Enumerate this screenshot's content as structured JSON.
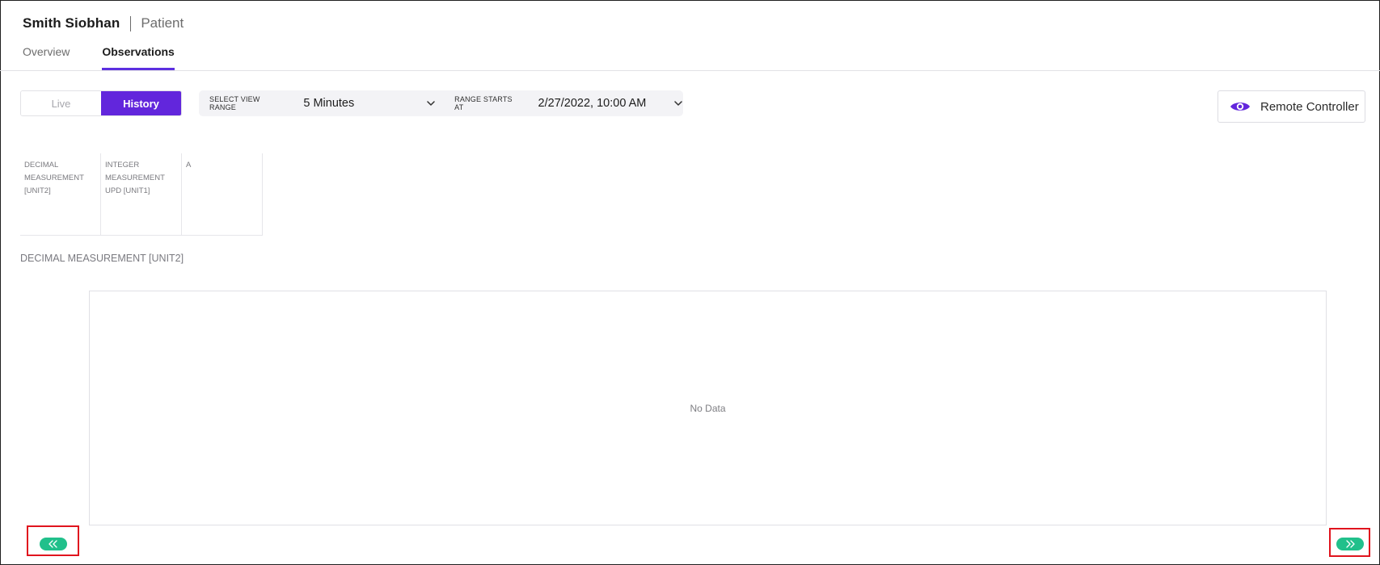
{
  "header": {
    "patient_name": "Smith Siobhan",
    "role": "Patient",
    "tabs": [
      {
        "label": "Overview",
        "active": false
      },
      {
        "label": "Observations",
        "active": true
      }
    ]
  },
  "toolbar": {
    "mode_toggle": {
      "live_label": "Live",
      "history_label": "History",
      "selected": "History"
    },
    "view_range": {
      "label": "SELECT VIEW RANGE",
      "value": "5 Minutes"
    },
    "range_start": {
      "label": "RANGE STARTS AT",
      "value": "2/27/2022, 10:00 AM"
    },
    "remote_controller": {
      "label": "Remote Controller",
      "icon": "eye-icon"
    }
  },
  "measurements": [
    {
      "label": "DECIMAL MEASUREMENT [UNIT2]"
    },
    {
      "label": "INTEGER MEASUREMENT UPD [UNIT1]"
    },
    {
      "label": "A"
    }
  ],
  "chart": {
    "title": "DECIMAL MEASUREMENT [UNIT2]",
    "empty_text": "No Data"
  },
  "navigation": {
    "prev_icon": "double-chevron-left-icon",
    "next_icon": "double-chevron-right-icon"
  },
  "colors": {
    "accent": "#6226dc",
    "tab_underline": "#5c2fe0",
    "nav_button": "#21c08b",
    "highlight": "#e0141e"
  }
}
